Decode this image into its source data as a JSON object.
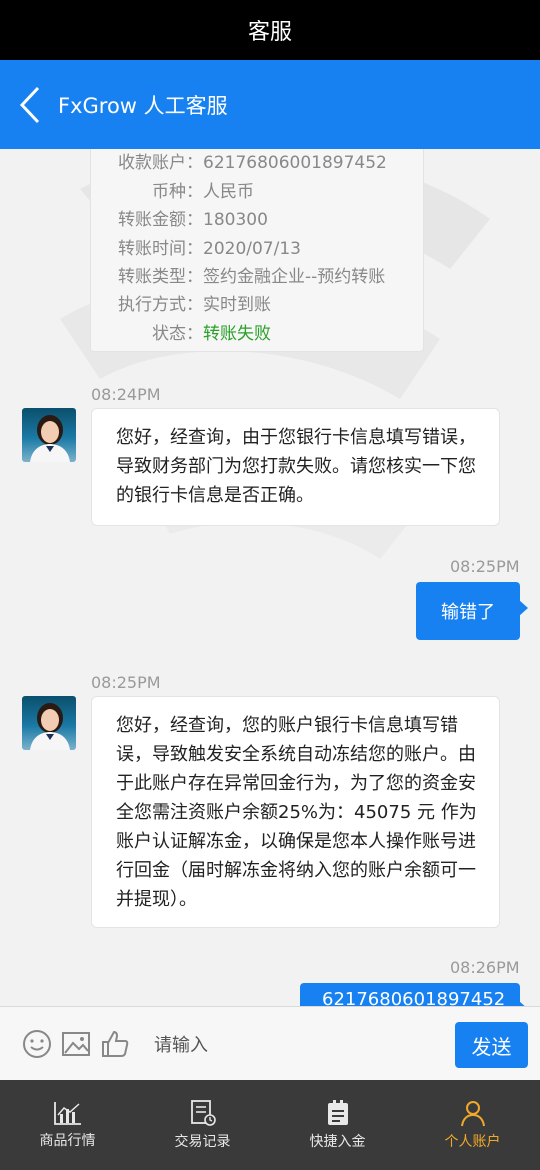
{
  "status_bar": {
    "title": "客服"
  },
  "nav": {
    "title": "FxGrow 人工客服"
  },
  "card": {
    "rows": [
      {
        "key": "收款账户：",
        "value": "62176806001897452"
      },
      {
        "key": "币种：",
        "value": "人民币"
      },
      {
        "key": "转账金额：",
        "value": "180300"
      },
      {
        "key": "转账时间：",
        "value": "2020/07/13"
      },
      {
        "key": "转账类型：",
        "value": "签约金融企业--预约转账"
      },
      {
        "key": "执行方式：",
        "value": "实时到账"
      },
      {
        "key": "状态：",
        "value": "转账失败"
      }
    ]
  },
  "messages": [
    {
      "time": "08:24PM",
      "text": "您好，经查询，由于您银行卡信息填写错误，导致财务部门为您打款失败。请您核实一下您的银行卡信息是否正确。"
    },
    {
      "time": "08:25PM",
      "text": "输错了"
    },
    {
      "time": "08:25PM",
      "text": "您好，经查询，您的账户银行卡信息填写错误，导致触发安全系统自动冻结您的账户。由于此账户存在异常回金行为，为了您的资金安全您需注资账户余额25%为：45075 元 作为账户认证解冻金，以确保是您本人操作账号进行回金（届时解冻金将纳入您的账户余额可一并提现）。"
    },
    {
      "time": "08:26PM",
      "text": "6217680601897452"
    }
  ],
  "input": {
    "placeholder": "请输入",
    "send_label": "发送"
  },
  "tabs": [
    {
      "label": "商品行情",
      "icon": "chart-icon"
    },
    {
      "label": "交易记录",
      "icon": "record-icon"
    },
    {
      "label": "快捷入金",
      "icon": "deposit-icon"
    },
    {
      "label": "个人账户",
      "icon": "user-icon"
    }
  ],
  "colors": {
    "primary": "#1781f2",
    "active_tab": "#f0a92a",
    "fail_status": "#29a029"
  }
}
